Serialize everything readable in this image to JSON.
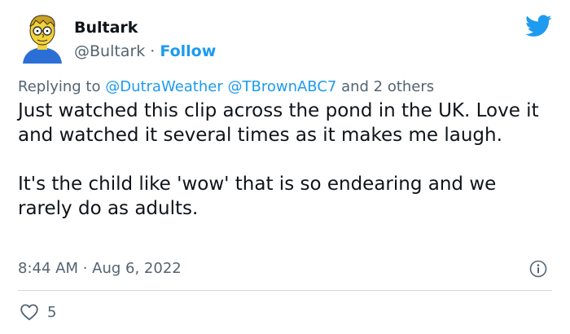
{
  "user": {
    "display_name": "Bultark",
    "handle": "@Bultark",
    "separator": " · ",
    "follow_label": "Follow"
  },
  "reply": {
    "prefix": "Replying to ",
    "mention_1": "@DutraWeather",
    "mention_2": "@TBrownABC7",
    "suffix": " and 2 others"
  },
  "body": {
    "paragraph_1": "Just watched this clip across the pond in the UK. Love it and watched it several times as it makes me laugh.",
    "paragraph_2": "It's the child like 'wow' that is so endearing and we rarely do as adults."
  },
  "meta": {
    "timestamp": "8:44 AM · Aug 6, 2022"
  },
  "engagement": {
    "like_count": "5"
  },
  "icons": {
    "brand": "twitter-bird-icon",
    "info": "info-icon",
    "like": "heart-icon"
  },
  "colors": {
    "accent": "#1d9bf0",
    "text_primary": "#0f1419",
    "text_secondary": "#536471",
    "divider": "#cfd9de"
  }
}
